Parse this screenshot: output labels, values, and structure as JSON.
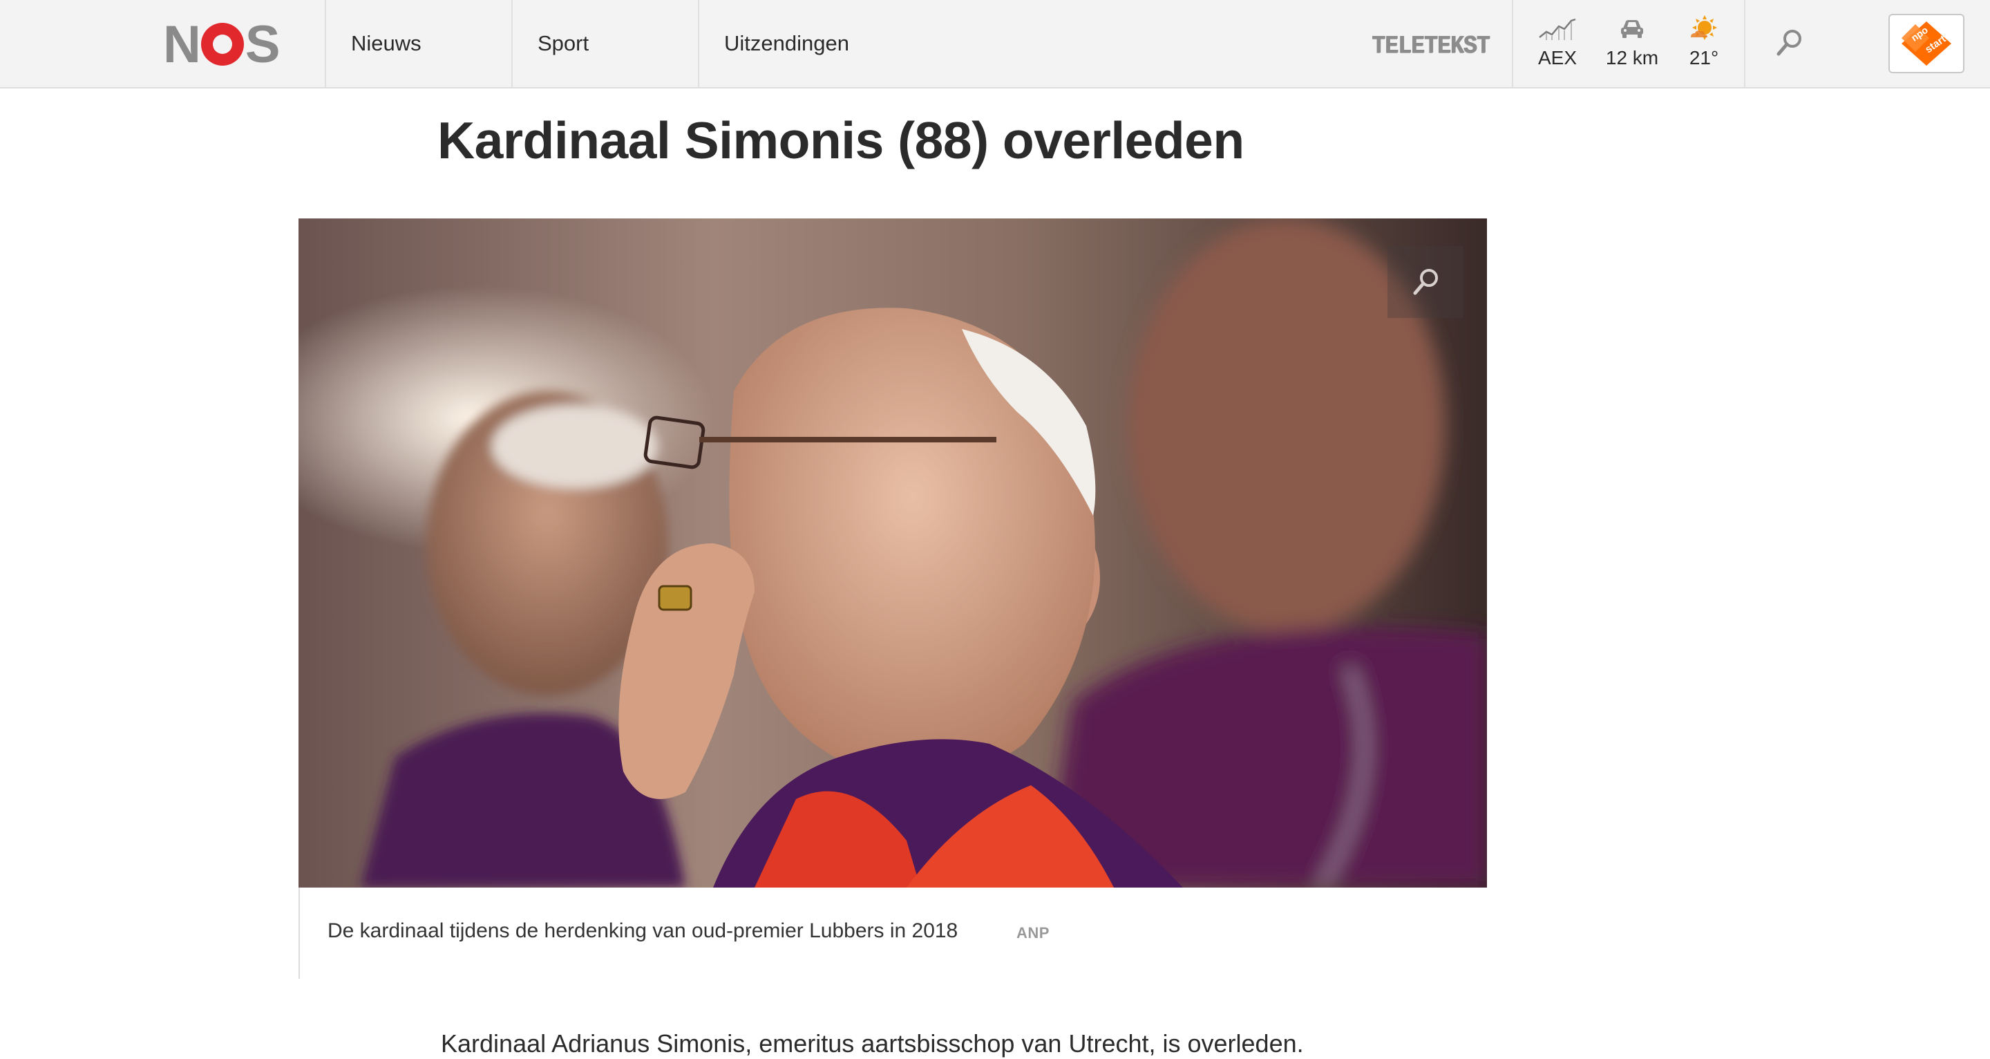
{
  "header": {
    "logo": "NOS",
    "nav": [
      "Nieuws",
      "Sport",
      "Uitzendingen"
    ],
    "teletekst": "TELETEKST",
    "widgets": {
      "aex_label": "AEX",
      "traffic_label": "12 km",
      "weather_label": "21°"
    },
    "npo_badge": "npo start"
  },
  "article": {
    "title": "Kardinaal Simonis (88) overleden",
    "image_caption": "De kardinaal tijdens de herdenking van oud-premier Lubbers in 2018",
    "image_credit": "ANP",
    "lead": "Kardinaal Adrianus Simonis, emeritus aartsbisschop van Utrecht, is overleden."
  },
  "colors": {
    "brand_red": "#e0282d",
    "header_bg": "#f3f3f3",
    "npo_orange": "#ff6d00"
  },
  "icons": [
    "search-icon",
    "chart-icon",
    "car-icon",
    "sun-icon",
    "zoom-icon"
  ]
}
